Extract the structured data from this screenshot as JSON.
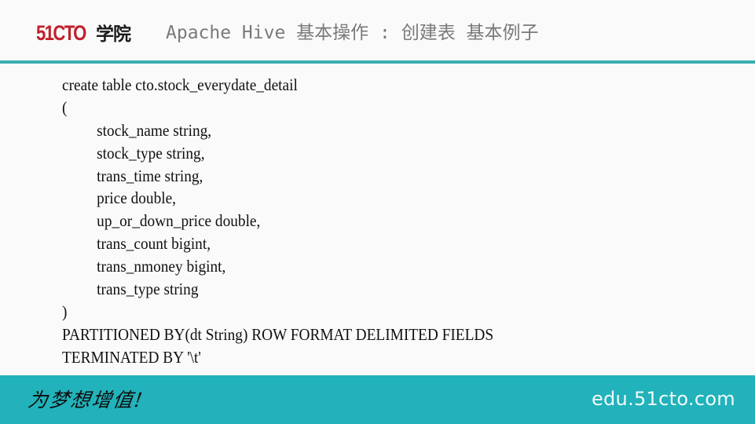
{
  "header": {
    "logo_number": "51CTO",
    "logo_text": "学院",
    "title": "Apache Hive 基本操作 : 创建表 基本例子"
  },
  "code": {
    "lines": [
      "create table cto.stock_everydate_detail",
      "(",
      "stock_name string,",
      "stock_type string,",
      "trans_time string,",
      "price double,",
      "up_or_down_price double,",
      "trans_count bigint,",
      "trans_nmoney bigint,",
      "trans_type string",
      ")",
      "PARTITIONED BY(dt String) ROW FORMAT DELIMITED FIELDS",
      "TERMINATED BY '\\t'"
    ]
  },
  "footer": {
    "slogan": "为梦想增值!",
    "site": "edu.51cto.com"
  },
  "colors": {
    "brand_red": "#c0202a",
    "accent_teal": "#3aaeb1",
    "footer_teal": "#22b2bb"
  }
}
